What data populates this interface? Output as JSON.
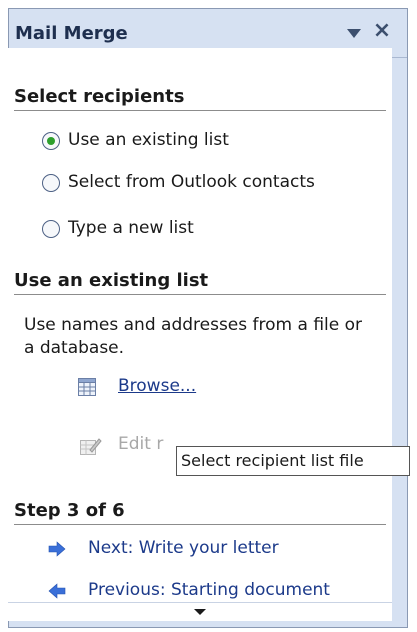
{
  "pane": {
    "title": "Mail Merge",
    "dropdown_icon": "triangle-down-icon",
    "close_icon": "close-icon"
  },
  "select_recipients": {
    "heading": "Select recipients",
    "options": [
      {
        "label": "Use an existing list",
        "selected": true
      },
      {
        "label": "Select from Outlook contacts",
        "selected": false
      },
      {
        "label": "Type a new list",
        "selected": false
      }
    ]
  },
  "existing_list": {
    "heading": "Use an existing list",
    "description": "Use names and addresses from a file or a database.",
    "browse_label": "Browse...",
    "browse_icon": "table-grid-icon",
    "edit_label": "Edit r",
    "edit_icon": "edit-list-icon"
  },
  "tooltip": {
    "text": "Select recipient list file"
  },
  "step": {
    "heading": "Step 3 of 6",
    "next_label": "Next: Write your letter",
    "previous_label": "Previous: Starting document"
  },
  "colors": {
    "pane_bg": "#d6e1f2",
    "link": "#1c3a8a",
    "arrow": "#3a6fd8",
    "radio_selected": "#2d9f2d",
    "disabled_text": "#a8a8a8"
  }
}
